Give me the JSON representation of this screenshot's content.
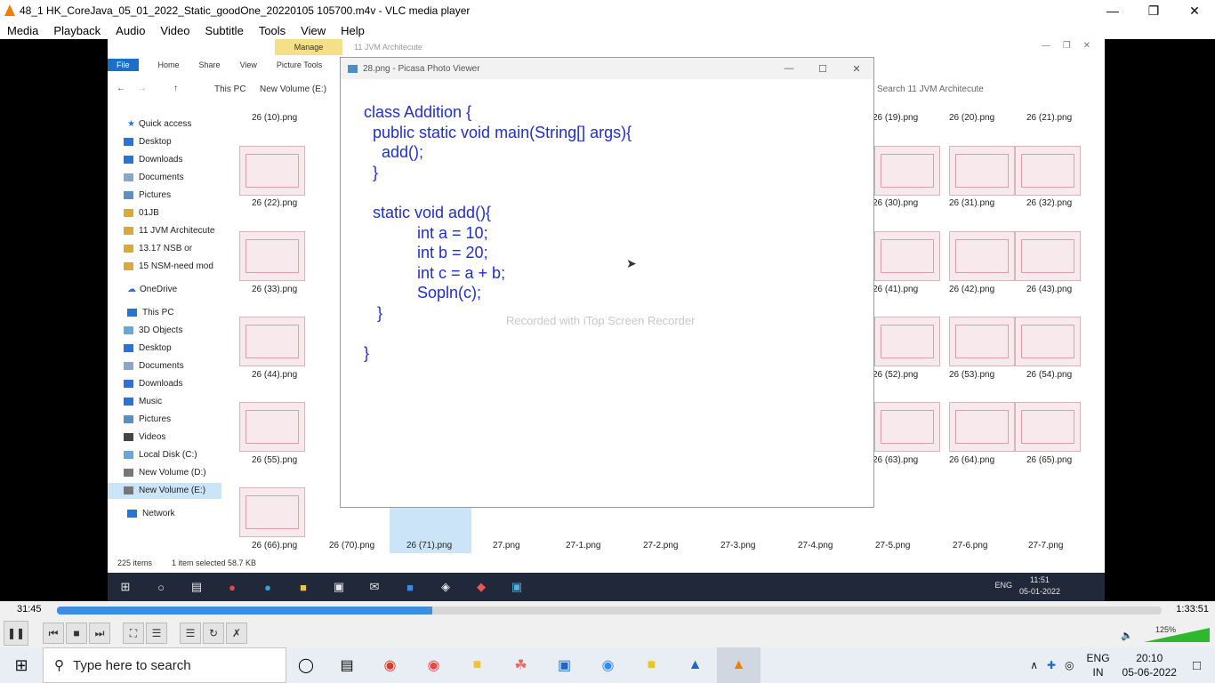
{
  "vlc": {
    "title": "48_1 HK_CoreJava_05_01_2022_Static_goodOne_20220105 105700.m4v - VLC media player",
    "menu": [
      "Media",
      "Playback",
      "Audio",
      "Video",
      "Subtitle",
      "Tools",
      "View",
      "Help"
    ],
    "time_elapsed": "31:45",
    "time_total": "1:33:51",
    "progress": 0.34,
    "volume_pct": "125%"
  },
  "explorer": {
    "manage_tab": "Manage",
    "window_title": "11 JVM Architecute",
    "ribbon": [
      "File",
      "Home",
      "Share",
      "View",
      "Picture Tools"
    ],
    "address": [
      "This PC",
      "New Volume (E:)"
    ],
    "search_placeholder": "Search 11 JVM Architecute",
    "nav": {
      "quick_access": "Quick access",
      "items": [
        "Desktop",
        "Downloads",
        "Documents",
        "Pictures",
        "01JB",
        "11 JVM Architecute",
        "13.17          NSB or",
        "15 NSM-need mod"
      ],
      "onedrive": "OneDrive",
      "this_pc": "This PC",
      "pc_items": [
        "3D Objects",
        "Desktop",
        "Documents",
        "Downloads",
        "Music",
        "Pictures",
        "Videos",
        "Local Disk (C:)",
        "New Volume (D:)",
        "New Volume (E:)"
      ],
      "network": "Network"
    },
    "thumb_labels_left": [
      [
        "26 (10).png",
        "26 (22).png",
        "26 (33).png",
        "26 (44).png",
        "26 (55).png",
        "26 (66).png"
      ]
    ],
    "thumb_labels_right": [
      [
        "26 (19).png",
        "26 (20).png",
        "26 (21).png"
      ],
      [
        "26 (30).png",
        "26 (31).png",
        "26 (32).png"
      ],
      [
        "26 (41).png",
        "26 (42).png",
        "26 (43).png"
      ],
      [
        "26 (52).png",
        "26 (53).png",
        "26 (54).png"
      ],
      [
        "26 (63).png",
        "26 (64).png",
        "26 (65).png"
      ]
    ],
    "bottom_row": [
      "26 (66).png",
      "26 (70).png",
      "26 (71).png",
      "27.png",
      "27-1.png",
      "27-2.png",
      "27-3.png",
      "27-4.png",
      "27-5.png",
      "27-6.png",
      "27-7.png"
    ],
    "status": {
      "count": "225 items",
      "selected": "1 item selected  58.7 KB"
    }
  },
  "picasa": {
    "title": "28.png - Picasa Photo Viewer",
    "code": "class Addition {\n  public static void main(String[] args){\n    add();\n  }\n\n  static void add(){\n            int a = 10;\n            int b = 20;\n            int c = a + b;\n            Sopln(c);\n   }\n\n}",
    "watermark": "Recorded with iTop Screen Recorder"
  },
  "inner_clock": {
    "time": "11:51",
    "date": "05-01-2022",
    "lang": "ENG"
  },
  "taskbar": {
    "search_placeholder": "Type here to search",
    "lang1": "ENG",
    "lang2": "IN",
    "time": "20:10",
    "date": "05-06-2022"
  }
}
